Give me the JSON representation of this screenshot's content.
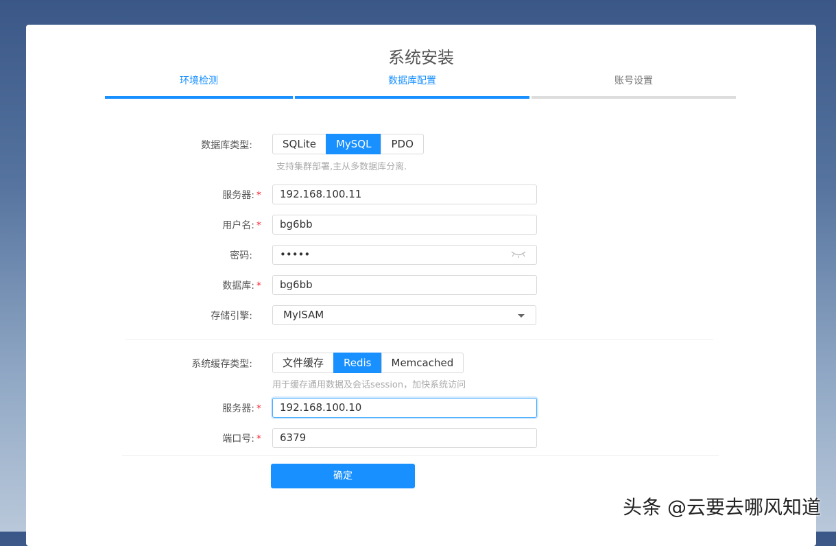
{
  "title": "系统安装",
  "steps": [
    {
      "label": "环境检测"
    },
    {
      "label": "数据库配置"
    },
    {
      "label": "账号设置"
    }
  ],
  "db_type": {
    "label": "数据库类型:",
    "options": [
      "SQLite",
      "MySQL",
      "PDO"
    ],
    "selected": "MySQL",
    "hint": "支持集群部署,主从多数据库分离."
  },
  "db_server": {
    "label": "服务器:",
    "required": "*",
    "value": "192.168.100.11"
  },
  "db_user": {
    "label": "用户名:",
    "required": "*",
    "value": "bg6bb"
  },
  "db_password": {
    "label": "密码:",
    "value": "•••••"
  },
  "db_name": {
    "label": "数据库:",
    "required": "*",
    "value": "bg6bb"
  },
  "db_engine": {
    "label": "存储引擎:",
    "value": "MyISAM"
  },
  "cache_type": {
    "label": "系统缓存类型:",
    "options": [
      "文件缓存",
      "Redis",
      "Memcached"
    ],
    "selected": "Redis",
    "hint": "用于缓存通用数据及会话session，加快系统访问"
  },
  "cache_server": {
    "label": "服务器:",
    "required": "*",
    "value": "192.168.100.10"
  },
  "cache_port": {
    "label": "端口号:",
    "required": "*",
    "value": "6379"
  },
  "confirm_label": "确定",
  "watermark": "头条 @云要去哪风知道",
  "colors": {
    "accent": "#1890ff",
    "required": "#f5222d"
  }
}
